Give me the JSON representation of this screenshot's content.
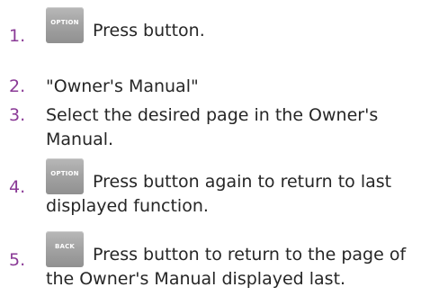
{
  "steps": [
    {
      "number": "1.",
      "button": "OPTION",
      "text": "Press button."
    },
    {
      "number": "2.",
      "text": "\"Owner's Manual\""
    },
    {
      "number": "3.",
      "text_line1": "Select the desired page in the Owner's",
      "text_line2": "Manual."
    },
    {
      "number": "4.",
      "button": "OPTION",
      "text_line1": "Press button again to return to last",
      "text_line2": "displayed function."
    },
    {
      "number": "5.",
      "button": "BACK",
      "text_line1": "Press button to return to the page of",
      "text_line2": "the Owner's Manual displayed last."
    }
  ],
  "colors": {
    "step_number": "#8a3a96",
    "text": "#262626",
    "button_fill": "#a4a4a4"
  }
}
